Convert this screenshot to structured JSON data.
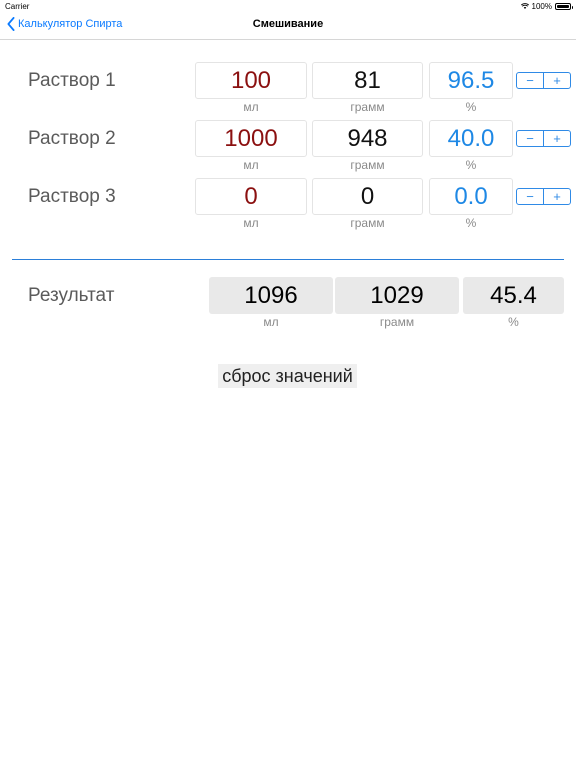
{
  "status": {
    "carrier": "Carrier",
    "battery": "100%",
    "battery_level": 1.0
  },
  "nav": {
    "back_label": "Калькулятор Спирта",
    "title": "Смешивание"
  },
  "units": {
    "ml": "мл",
    "gram": "грамм",
    "percent": "%"
  },
  "stepper": {
    "minus": "−",
    "plus": "+"
  },
  "solutions": [
    {
      "label": "Раствор 1",
      "ml": "100",
      "gram": "81",
      "percent": "96.5"
    },
    {
      "label": "Раствор 2",
      "ml": "1000",
      "gram": "948",
      "percent": "40.0"
    },
    {
      "label": "Раствор 3",
      "ml": "0",
      "gram": "0",
      "percent": "0.0"
    }
  ],
  "result": {
    "label": "Результат",
    "ml": "1096",
    "gram": "1029",
    "percent": "45.4"
  },
  "reset_label": "сброс значений",
  "colors": {
    "accent": "#0a7aff",
    "ml_value": "#8b1010",
    "percent_value": "#1e88e5",
    "divider": "#2b7fd9"
  }
}
